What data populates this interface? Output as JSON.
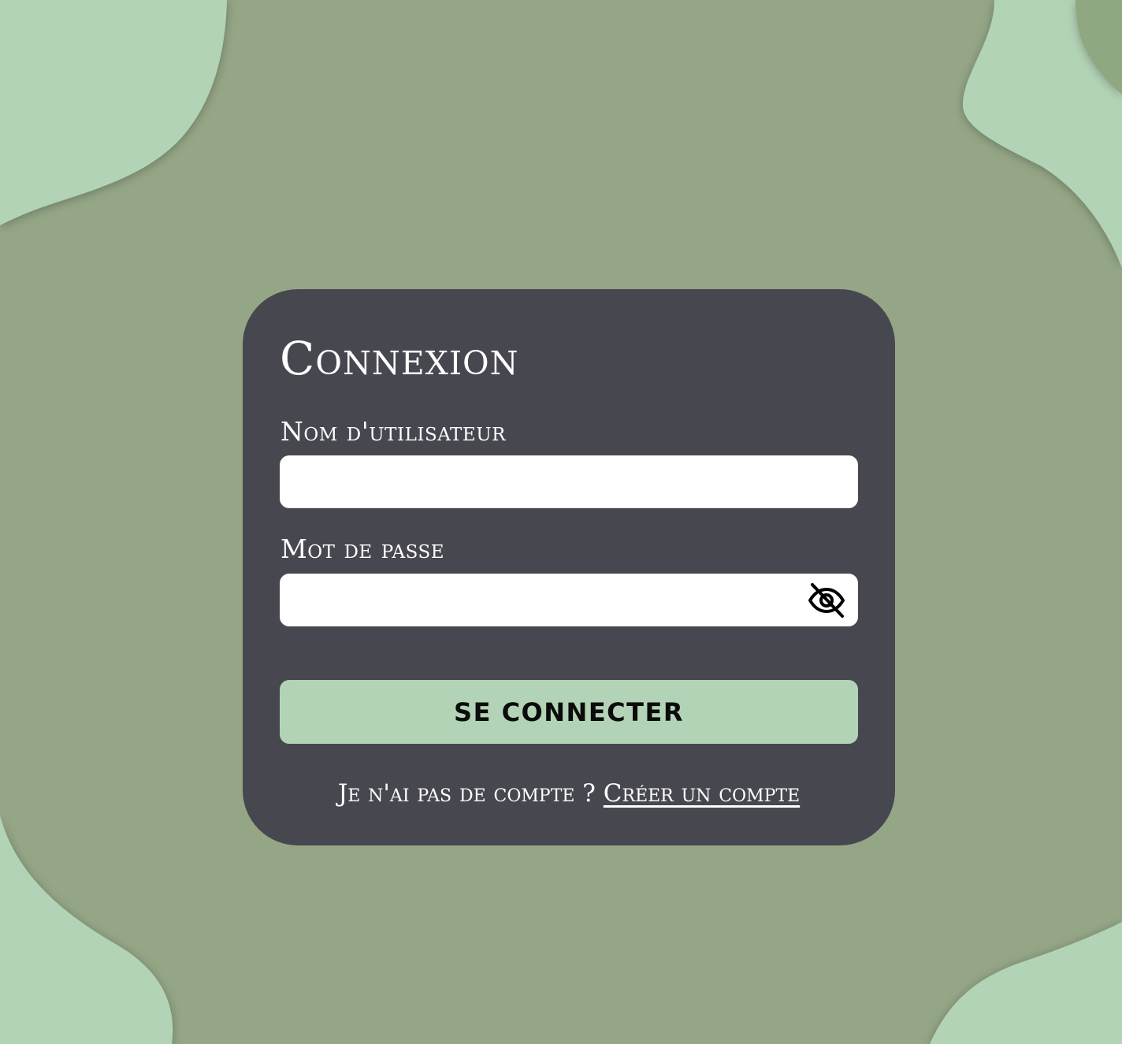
{
  "theme": {
    "background": "#94a686",
    "blob": "#b3d3b6",
    "blob_dark": "#8fa882",
    "card": "#474750",
    "button": "#b3d3b6"
  },
  "login": {
    "title": "Connexion",
    "username_label": "Nom d'utilisateur",
    "username_value": "",
    "password_label": "Mot de passe",
    "password_value": "",
    "password_toggle_icon": "eye-off-icon",
    "submit_label": "SE CONNECTER",
    "footer_text": "Je n'ai pas de compte ?",
    "signup_link": "Créer un compte"
  }
}
